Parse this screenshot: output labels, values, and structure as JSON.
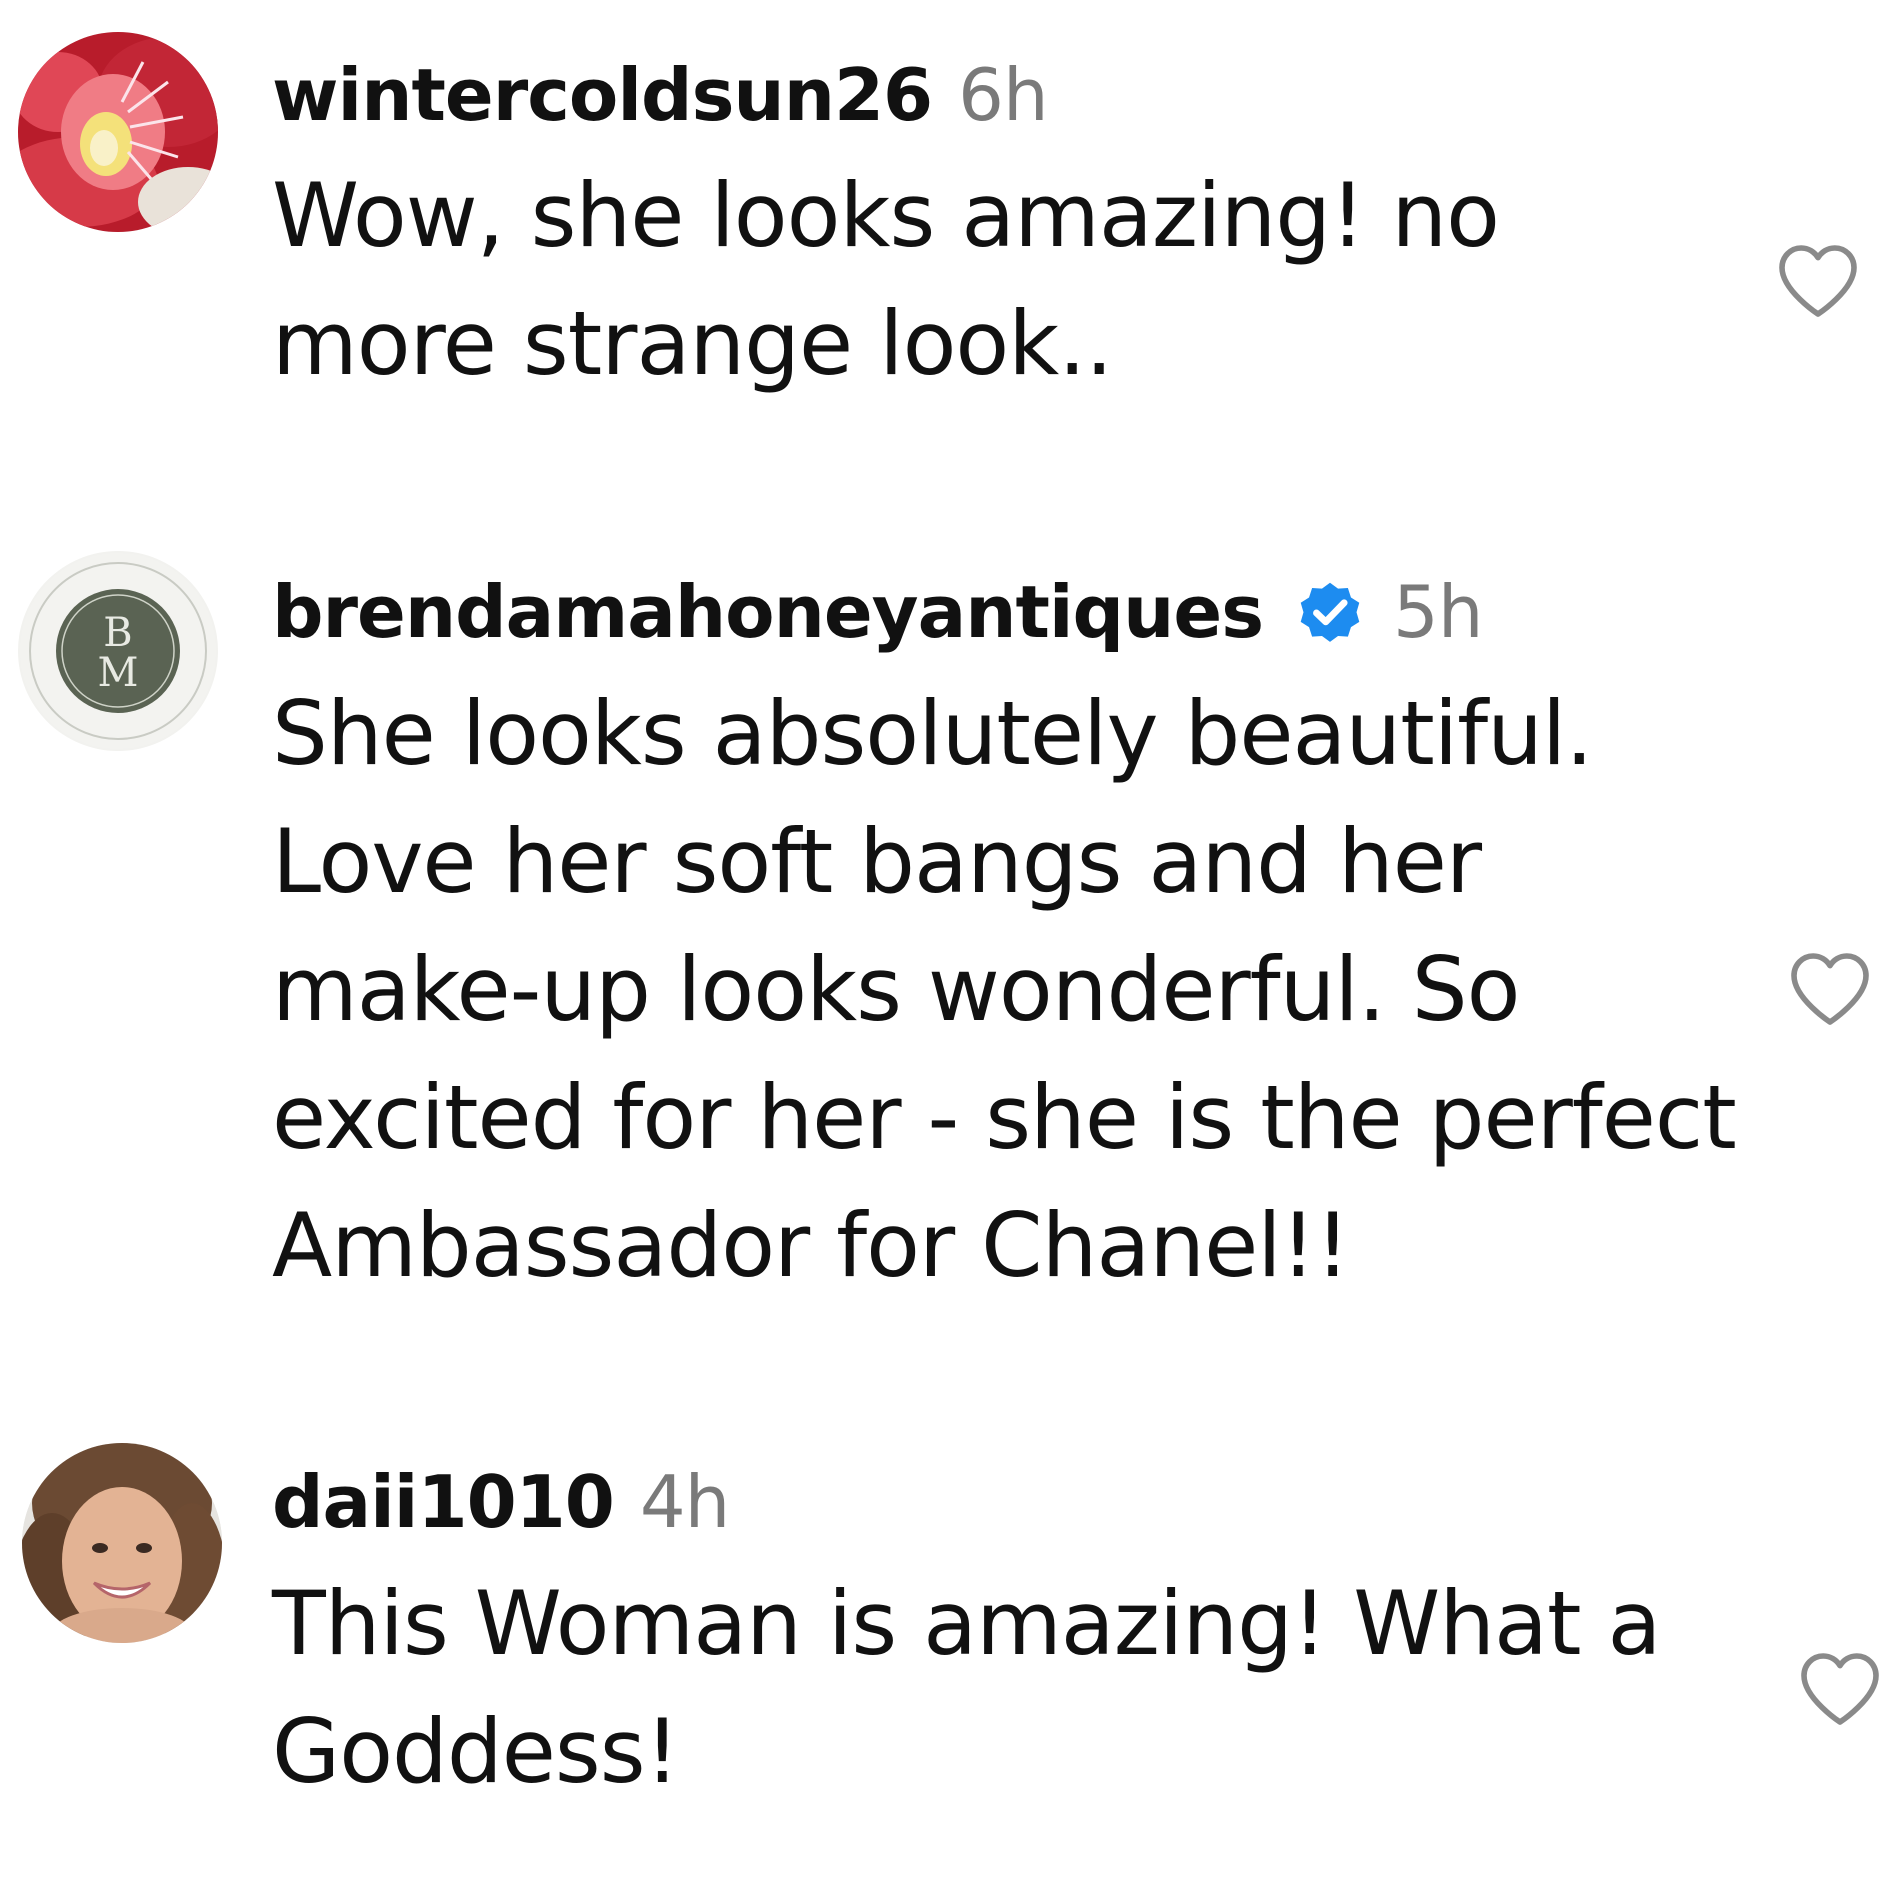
{
  "comments": [
    {
      "username": "wintercoldsun26",
      "time": "6h",
      "verified": false,
      "text": "Wow, she looks amazing! no more strange look..",
      "avatar_icon": "red-flower-photo"
    },
    {
      "username": "brendamahoneyantiques",
      "time": "5h",
      "verified": true,
      "text": "She looks absolutely beautiful. Love her soft bangs and her make-up looks wonderful. So excited for her - she is the perfect Ambassador for Chanel!!",
      "avatar_icon": "bm-monogram-logo"
    },
    {
      "username": "daii1010",
      "time": "4h",
      "verified": false,
      "text": "This Woman is amazing! What a Goddess!",
      "avatar_icon": "woman-smiling-photo"
    }
  ],
  "colors": {
    "text": "#111111",
    "timestamp": "#7a7a7a",
    "verified_badge": "#1d8cf0",
    "like_outline": "#8a8a8a"
  }
}
